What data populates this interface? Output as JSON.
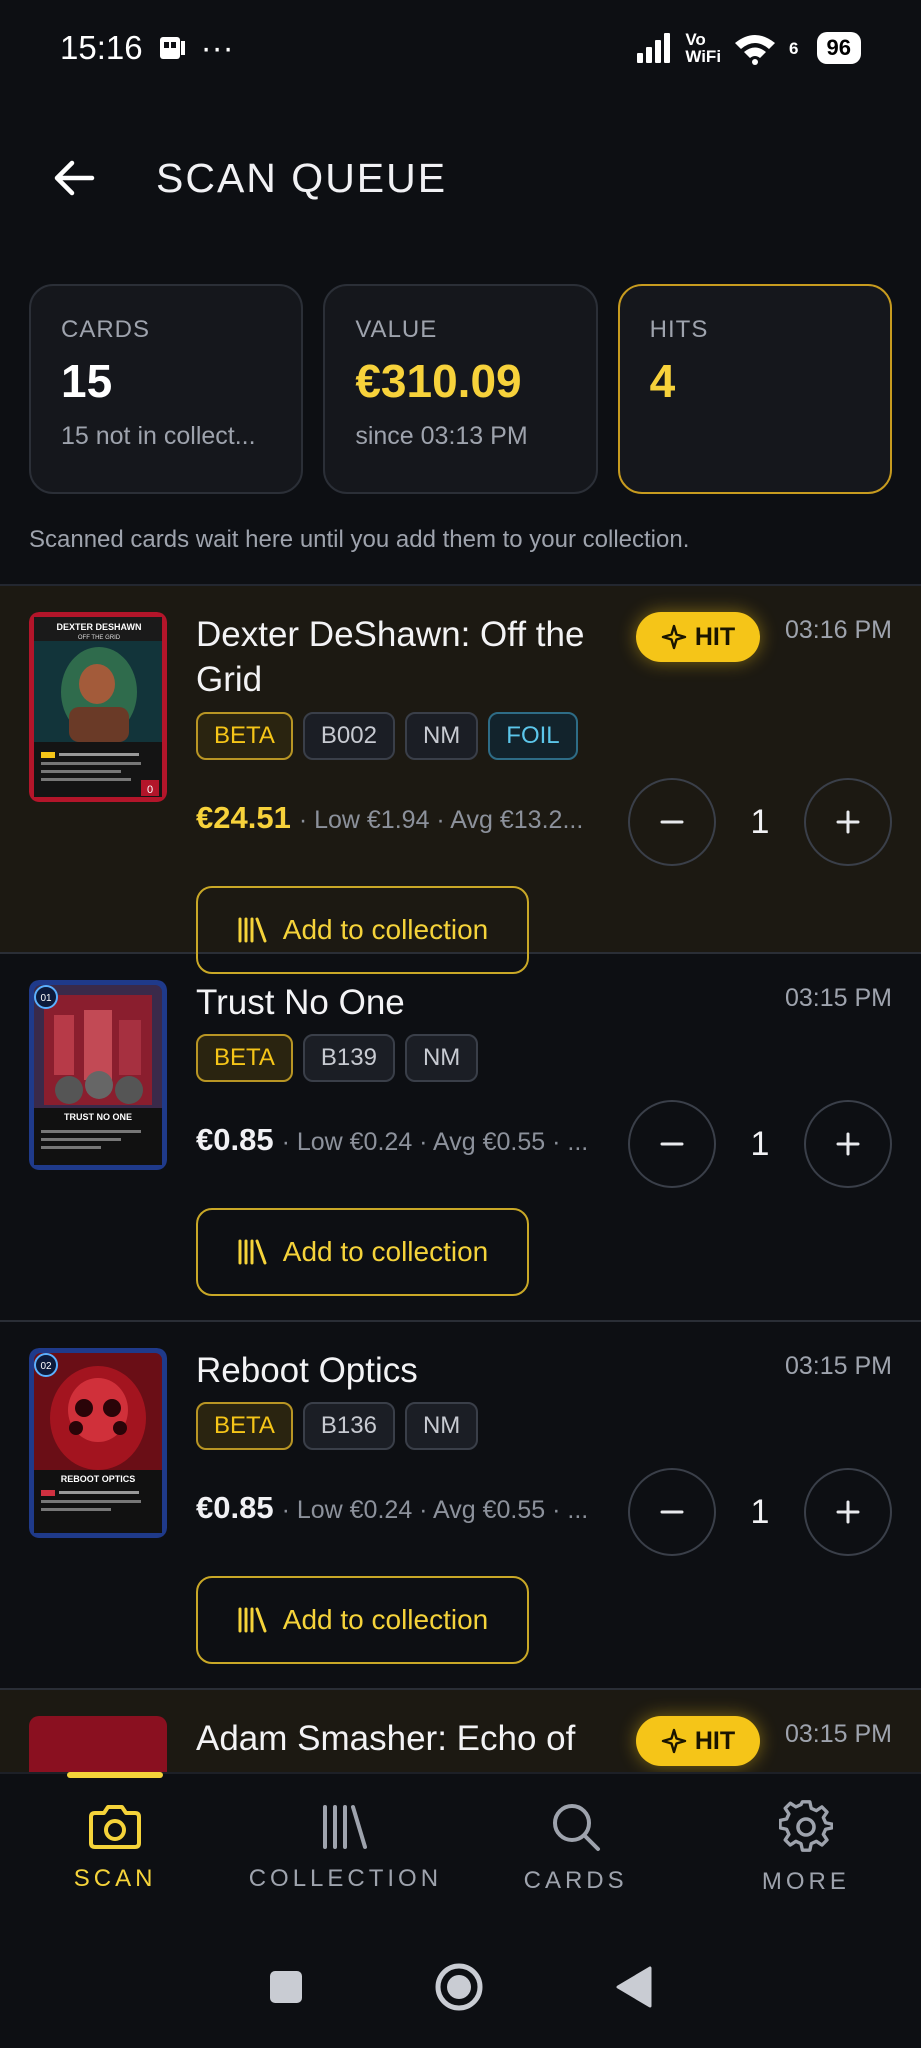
{
  "status_bar": {
    "time": "15:16",
    "dots": "···",
    "wifi_top": "Vo",
    "wifi_bottom": "WiFi",
    "wifi_num": "6",
    "battery": "96"
  },
  "header": {
    "title": "SCAN QUEUE"
  },
  "stats": [
    {
      "label": "CARDS",
      "value": "15",
      "sub": "15 not in collect..."
    },
    {
      "label": "VALUE",
      "value": "€310.09",
      "sub": "since 03:13 PM"
    },
    {
      "label": "HITS",
      "value": "4",
      "sub": ""
    }
  ],
  "hint": "Scanned cards wait here until you add them to your collection.",
  "items": [
    {
      "name": "Dexter DeShawn: Off the Grid",
      "time": "03:16 PM",
      "hit_label": "HIT",
      "tags": [
        "BETA",
        "B002",
        "NM",
        "FOIL"
      ],
      "price": "€24.51",
      "price_meta": "· Low €1.94 · Avg €13.2...",
      "qty": "1",
      "add_label": "Add to collection",
      "thumb_title": "DEXTER DESHAWN",
      "thumb_subtitle": "OFF THE GRID",
      "thumb_cost": "0"
    },
    {
      "name": "Trust No One",
      "time": "03:15 PM",
      "tags": [
        "BETA",
        "B139",
        "NM"
      ],
      "price": "€0.85",
      "price_meta": "· Low €0.24 · Avg €0.55 · ...",
      "qty": "1",
      "add_label": "Add to collection",
      "thumb_title": "TRUST NO ONE",
      "thumb_num": "01"
    },
    {
      "name": "Reboot Optics",
      "time": "03:15 PM",
      "tags": [
        "BETA",
        "B136",
        "NM"
      ],
      "price": "€0.85",
      "price_meta": "· Low €0.24 · Avg €0.55 · ...",
      "qty": "1",
      "add_label": "Add to collection",
      "thumb_title": "REBOOT OPTICS",
      "thumb_num": "02"
    },
    {
      "name": "Adam Smasher: Echo of",
      "time": "03:15 PM",
      "hit_label": "HIT"
    }
  ],
  "nav": [
    {
      "label": "SCAN",
      "icon": "camera-icon"
    },
    {
      "label": "COLLECTION",
      "icon": "collection-icon"
    },
    {
      "label": "CARDS",
      "icon": "search-icon"
    },
    {
      "label": "MORE",
      "icon": "gear-icon"
    }
  ],
  "colors": {
    "accent": "#f5c518",
    "background": "#0d0f13",
    "foil": "#5cc6ea"
  }
}
